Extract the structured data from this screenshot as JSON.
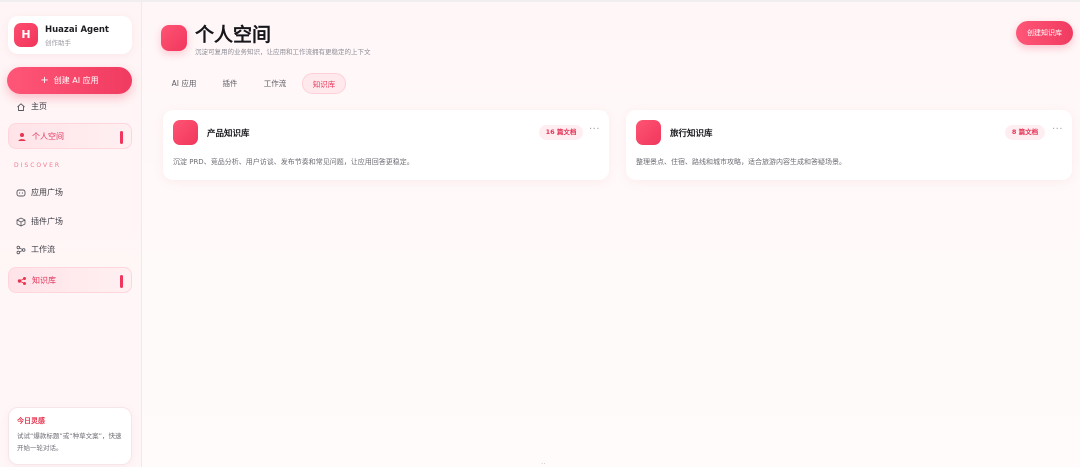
{
  "brand": {
    "initial": "H",
    "name": "Huazai Agent",
    "subtitle": "创作助手"
  },
  "sidebar": {
    "create_button": "创建 AI 应用",
    "items_top": [
      {
        "label": "主页",
        "icon": "home-icon"
      },
      {
        "label": "个人空间",
        "icon": "user-icon",
        "active": true
      }
    ],
    "section_label": "DISCOVER",
    "items_discover": [
      {
        "label": "应用广场",
        "icon": "app-icon"
      },
      {
        "label": "插件广场",
        "icon": "cube-icon"
      },
      {
        "label": "工作流",
        "icon": "workflow-icon"
      },
      {
        "label": "知识库",
        "icon": "knowledge-icon",
        "active": true
      }
    ],
    "tip": {
      "title": "今日灵感",
      "text": "试试“爆款标题”或“种草文案”，快速开始一轮对话。"
    }
  },
  "header": {
    "title": "个人空间",
    "subtitle": "沉淀可复用的业务知识，让应用和工作流拥有更稳定的上下文",
    "create_button": "创建知识库"
  },
  "tabs": [
    {
      "label": "AI 应用",
      "active": false
    },
    {
      "label": "插件",
      "active": false
    },
    {
      "label": "工作流",
      "active": false
    },
    {
      "label": "知识库",
      "active": true
    }
  ],
  "cards": [
    {
      "title": "产品知识库",
      "badge": "16 篇文档",
      "more": "···",
      "description": "沉淀 PRD、竞品分析、用户访谈、发布节奏和常见问题，让应用回答更稳定。"
    },
    {
      "title": "旅行知识库",
      "badge": "8 篇文档",
      "more": "···",
      "description": "整理景点、住宿、路线和城市攻略，适合旅游内容生成和答疑场景。"
    }
  ],
  "footer_glyph": "··",
  "colors": {
    "accent": "#f0365c",
    "accent_light": "#ffe9ed",
    "text": "#1f1f24"
  }
}
